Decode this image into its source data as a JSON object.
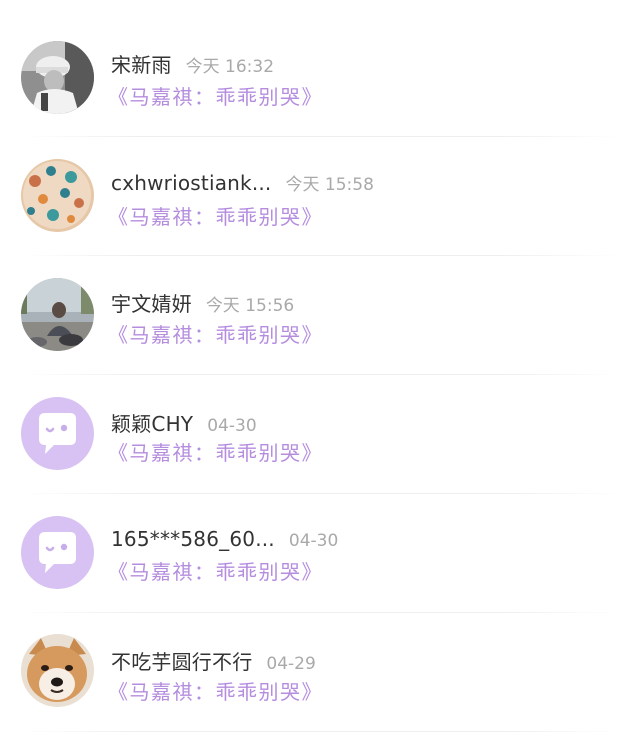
{
  "comments": [
    {
      "name": "宋新雨",
      "time": "今天 16:32",
      "song": "《马嘉祺：乖乖别哭》",
      "avatar": "photo-avatar-girl-cap"
    },
    {
      "name": "cxhwriostiank...",
      "time": "今天 15:58",
      "song": "《马嘉祺：乖乖别哭》",
      "avatar": "photo-avatar-cookie"
    },
    {
      "name": "宇文婧妍",
      "time": "今天 15:56",
      "song": "《马嘉祺：乖乖别哭》",
      "avatar": "photo-avatar-street"
    },
    {
      "name": "颖颖CHY",
      "time": "04-30",
      "song": "《马嘉祺：乖乖别哭》",
      "avatar": "default-chat-bubble-icon"
    },
    {
      "name": "165***586_60...",
      "time": "04-30",
      "song": "《马嘉祺：乖乖别哭》",
      "avatar": "default-chat-bubble-icon"
    },
    {
      "name": "不吃芋圆行不行",
      "time": "04-29",
      "song": "《马嘉祺：乖乖别哭》",
      "avatar": "photo-avatar-shiba-dog"
    }
  ],
  "colors": {
    "name": "#333333",
    "time": "#a9a9a9",
    "song_link": "#b58ddf",
    "default_avatar_bg": "#d7c2f3"
  }
}
